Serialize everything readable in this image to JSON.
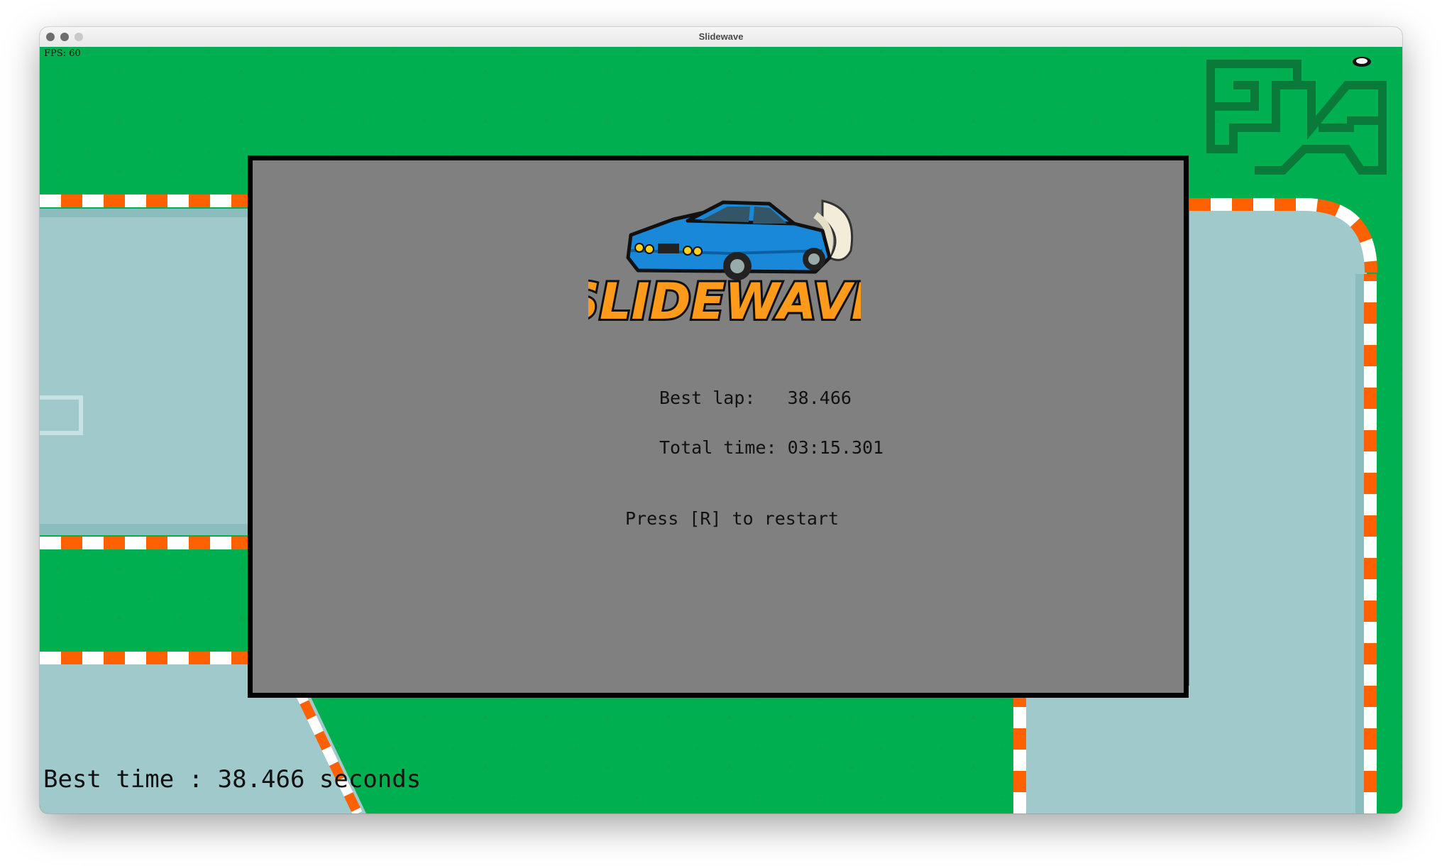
{
  "window": {
    "title": "Slidewave"
  },
  "hud": {
    "fps": "FPS: 60",
    "best_time": "Best time : 38.466 seconds"
  },
  "overlay": {
    "logo_text": "SLIDEWAVE",
    "best_lap_label": "Best lap:",
    "best_lap_value": "38.466",
    "total_time_label": "Total time:",
    "total_time_value": "03:15.301",
    "restart_hint": "Press [R] to restart"
  },
  "colors": {
    "grass": "#00b050",
    "track": "#9fc9cb",
    "curb_orange": "#ff6000",
    "curb_white": "#ffffff",
    "overlay_bg": "#808080",
    "logo_orange": "#ff9a1a",
    "car_blue": "#1a88d8"
  }
}
